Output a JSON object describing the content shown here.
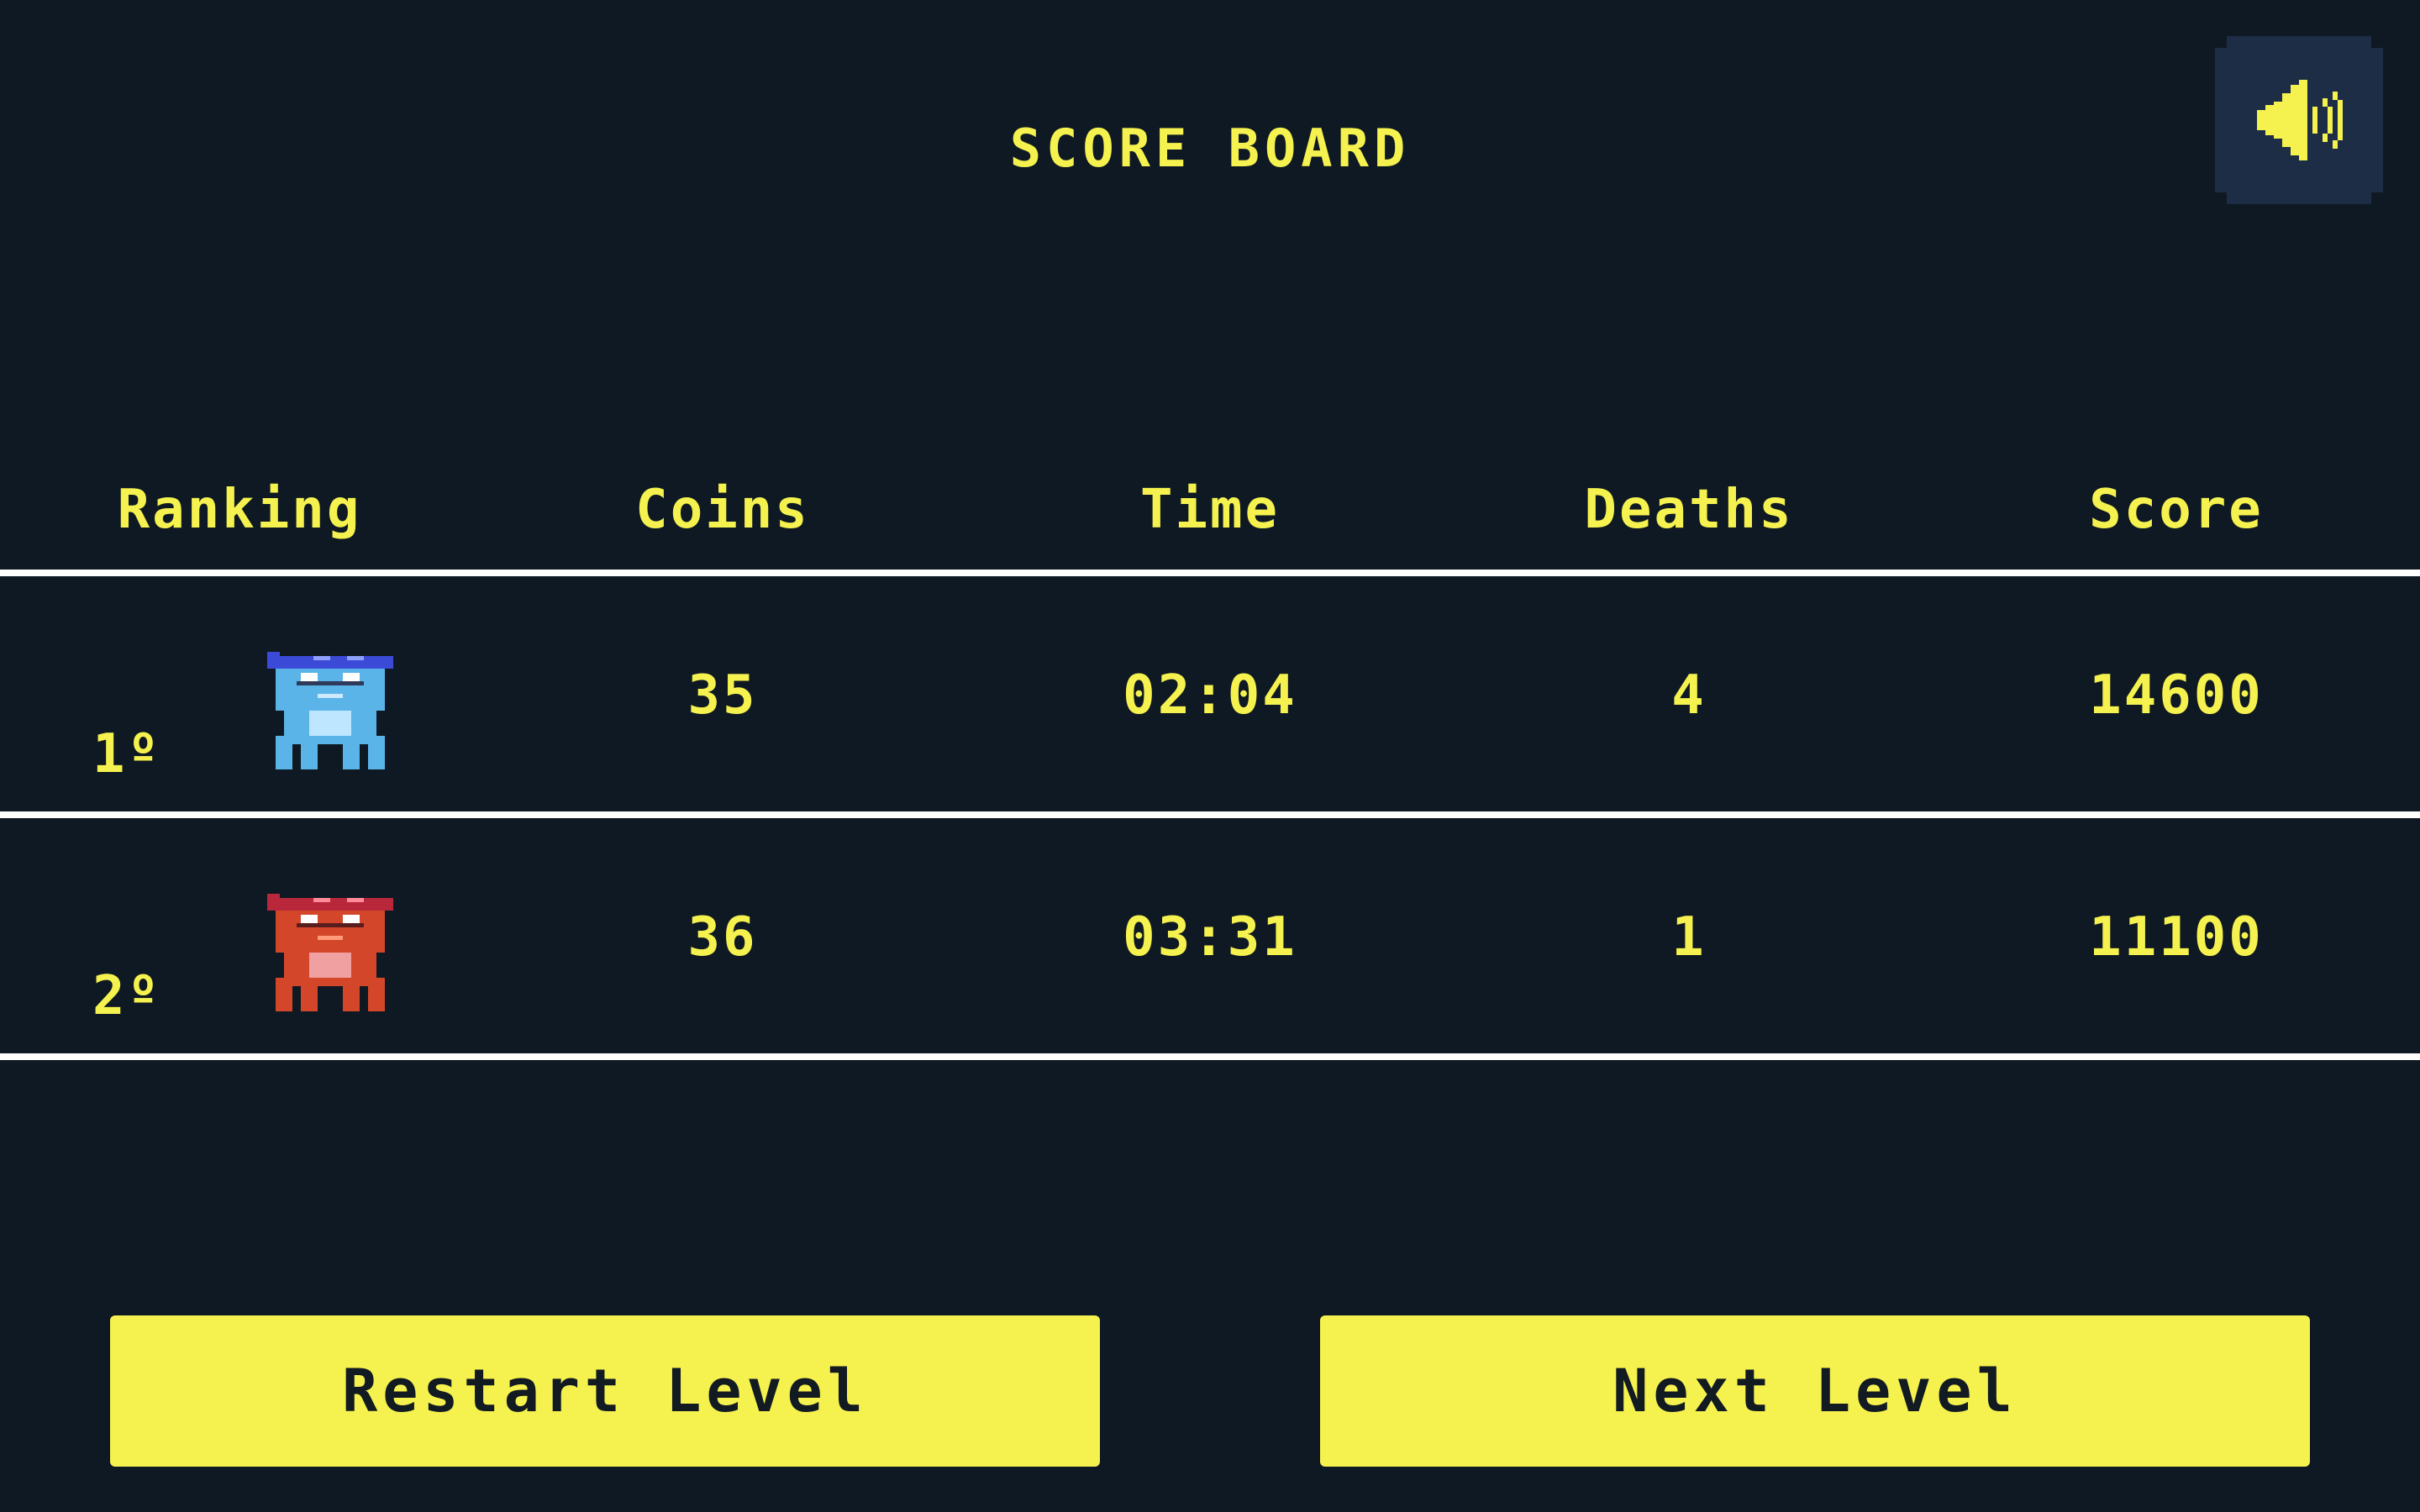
{
  "title": "SCORE BOARD",
  "sound_button": {
    "icon": "speaker-icon"
  },
  "table": {
    "headers": [
      "Ranking",
      "Coins",
      "Time",
      "Deaths",
      "Score"
    ],
    "rows": [
      {
        "rank": "1º",
        "avatar": "blue-frog-avatar",
        "coins": "35",
        "time": "02:04",
        "deaths": "4",
        "score": "14600"
      },
      {
        "rank": "2º",
        "avatar": "red-frog-avatar",
        "coins": "36",
        "time": "03:31",
        "deaths": "1",
        "score": "11100"
      }
    ]
  },
  "buttons": {
    "restart": "Restart Level",
    "next": "Next Level"
  },
  "colors": {
    "background": "#0f1923",
    "accent": "#f5f24f",
    "sound_button_bg": "#1d2d45",
    "divider": "#ffffff"
  }
}
